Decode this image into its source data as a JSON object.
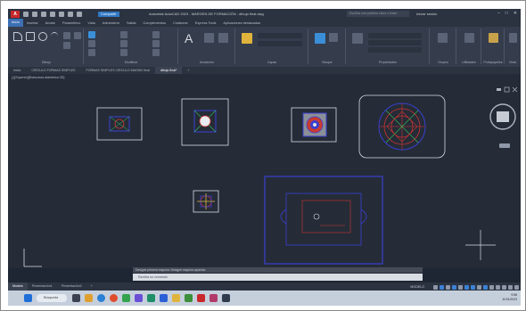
{
  "window": {
    "app_logo": "A",
    "share_label": "Compartir",
    "title": "Autodesk AutoCAD 2023 - MARGEN DE FORMACIÓN - dibujo final.dwg",
    "search_placeholder": "Escriba una palabra clave o frase",
    "user_label": "Iniciar sesión"
  },
  "menu_tabs": [
    "Inicio",
    "Insertar",
    "Anotar",
    "Paramétrico",
    "Vista",
    "Administrar",
    "Salida",
    "Complementos",
    "Colaborar",
    "Express Tools",
    "Aplicaciones destacadas"
  ],
  "ribbon_groups": [
    "Dibujo",
    "Modificar",
    "Anotación",
    "Capas",
    "Bloque",
    "Propiedades",
    "Grupos",
    "Utilidades",
    "Portapapeles",
    "Vista"
  ],
  "file_tabs": [
    "Inicio",
    "CIRCULO FORMAS SIMPLES",
    "FORMAS SIMPLES CIRCULO MAGNO final",
    "dibujo final*"
  ],
  "viewport_label": "[-][Superior][Estructura alámbrica 2D]",
  "command": {
    "history": "Designe primera esquina: Designe esquina opuesta:",
    "prompt": "Escriba un comando"
  },
  "layout_tabs": [
    "Modelo",
    "Presentación1",
    "Presentación2"
  ],
  "status_text": "MODELO",
  "taskbar": {
    "search_label": "Búsqueda",
    "time": "9:58",
    "date": "11/01/2023"
  },
  "colors": {
    "accent": "#3c6fb3",
    "drawing_white": "#d8dde6",
    "drawing_blue": "#3a3fd0",
    "drawing_red": "#d23232",
    "drawing_green": "#35c35a"
  }
}
